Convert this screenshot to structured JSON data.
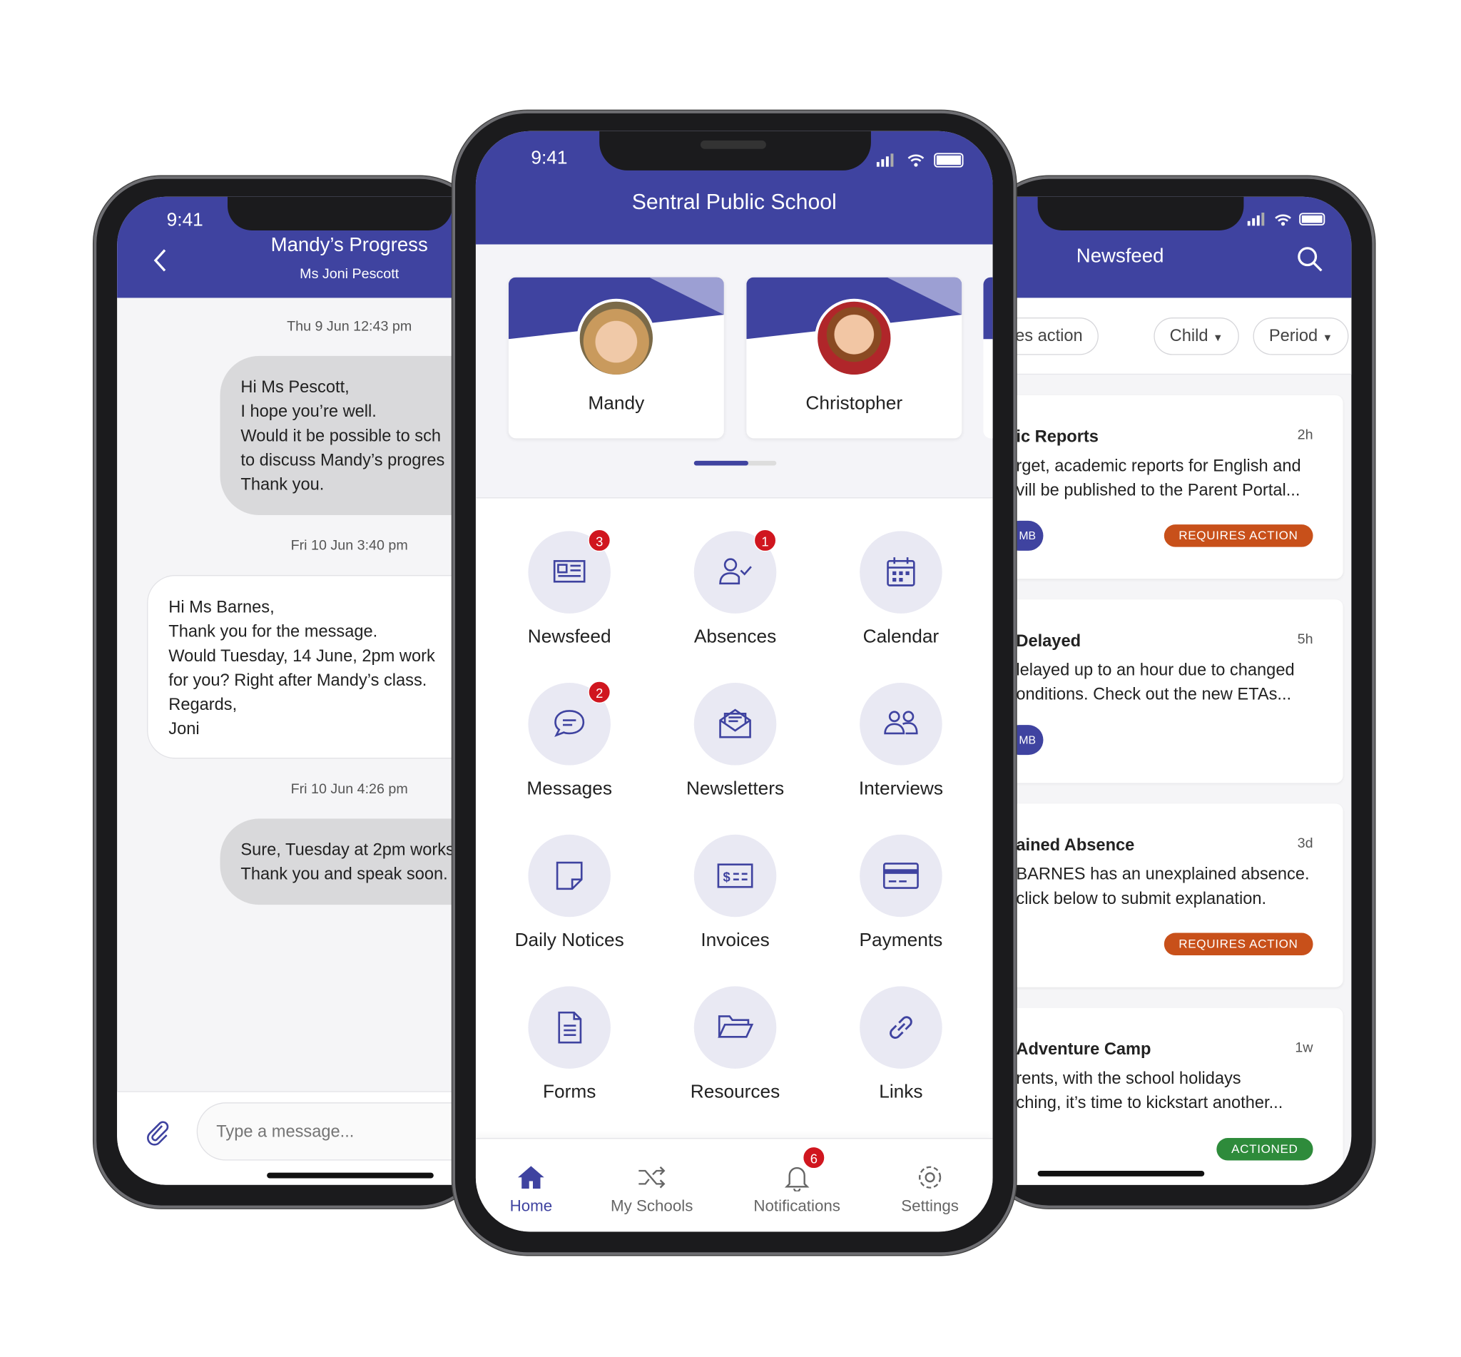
{
  "colors": {
    "brand": "#3f43a0",
    "requires_action": "#c8501a",
    "actioned": "#2e8b3b",
    "badge": "#d0161f"
  },
  "status_bar": {
    "time": "9:41"
  },
  "messages_screen": {
    "title": "Mandy’s Progress",
    "subtitle": "Ms Joni Pescott",
    "thread": [
      {
        "date": "Thu 9 Jun 12:43 pm",
        "from": "me",
        "lines": [
          "Hi Ms Pescott,",
          "I hope you’re well.",
          "Would it be possible to sch",
          "to discuss Mandy’s progres",
          "Thank you."
        ]
      },
      {
        "date": "Fri 10 Jun 3:40 pm",
        "from": "teacher",
        "lines": [
          "Hi Ms Barnes,",
          "Thank you for the message.",
          "Would Tuesday, 14 June, 2pm work",
          "for you? Right after Mandy’s class.",
          "Regards,",
          "Joni"
        ]
      },
      {
        "date": "Fri 10 Jun 4:26 pm",
        "from": "me",
        "lines": [
          "Sure, Tuesday at 2pm works",
          "Thank you and speak soon."
        ]
      }
    ],
    "input_placeholder": "Type a message..."
  },
  "home_screen": {
    "title": "Sentral Public School",
    "children": [
      {
        "name": "Mandy"
      },
      {
        "name": "Christopher"
      }
    ],
    "pager": {
      "pages": 2,
      "active": 1
    },
    "tiles": [
      {
        "label": "Newsfeed",
        "icon": "newspaper-icon",
        "badge": "3"
      },
      {
        "label": "Absences",
        "icon": "user-check-icon",
        "badge": "1"
      },
      {
        "label": "Calendar",
        "icon": "calendar-icon",
        "badge": null
      },
      {
        "label": "Messages",
        "icon": "chat-icon",
        "badge": "2"
      },
      {
        "label": "Newsletters",
        "icon": "envelope-open-icon",
        "badge": null
      },
      {
        "label": "Interviews",
        "icon": "users-icon",
        "badge": null
      },
      {
        "label": "Daily Notices",
        "icon": "note-icon",
        "badge": null
      },
      {
        "label": "Invoices",
        "icon": "invoice-icon",
        "badge": null
      },
      {
        "label": "Payments",
        "icon": "credit-card-icon",
        "badge": null
      },
      {
        "label": "Forms",
        "icon": "document-icon",
        "badge": null
      },
      {
        "label": "Resources",
        "icon": "folder-icon",
        "badge": null
      },
      {
        "label": "Links",
        "icon": "link-icon",
        "badge": null
      }
    ],
    "tabbar": [
      {
        "label": "Home",
        "icon": "home-icon",
        "active": true
      },
      {
        "label": "My Schools",
        "icon": "shuffle-icon"
      },
      {
        "label": "Notifications",
        "icon": "bell-icon",
        "badge": "6"
      },
      {
        "label": "Settings",
        "icon": "gear-icon"
      }
    ]
  },
  "newsfeed_screen": {
    "title": "Newsfeed",
    "filters": [
      "equires action",
      "Child",
      "Period"
    ],
    "items": [
      {
        "title": "ic Reports",
        "time": "2h",
        "lines": [
          "rget, academic reports for English and",
          "vill be published to the Parent Portal..."
        ],
        "avatar": "MB",
        "status": "REQUIRES ACTION"
      },
      {
        "title": "Delayed",
        "time": "5h",
        "lines": [
          "lelayed up to an hour due to changed",
          "onditions. Check out the new ETAs..."
        ],
        "avatar": "MB",
        "status": null
      },
      {
        "title": "ained Absence",
        "time": "3d",
        "lines": [
          "BARNES has an unexplained absence.",
          "click below to submit explanation."
        ],
        "avatar": null,
        "status": "REQUIRES ACTION"
      },
      {
        "title": "Adventure Camp",
        "time": "1w",
        "lines": [
          "rents, with the school holidays",
          "ching, it’s time to kickstart another..."
        ],
        "avatar": null,
        "status": "ACTIONED"
      }
    ]
  }
}
